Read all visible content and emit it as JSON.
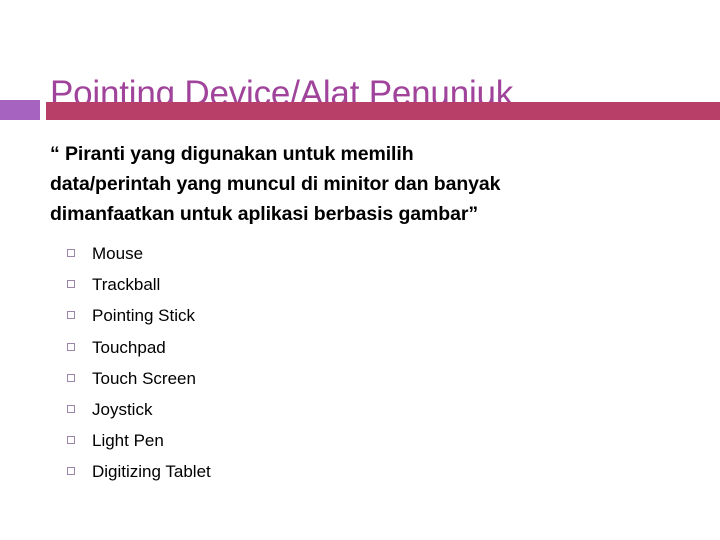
{
  "slide": {
    "title": "Pointing Device/Alat Penunjuk",
    "body_lines": [
      "“ Piranti yang digunakan untuk memilih",
      "data/perintah yang muncul di minitor dan banyak",
      "dimanfaatkan untuk aplikasi berbasis gambar”"
    ],
    "list_items": [
      {
        "label": "Mouse",
        "bullet": "hollow-square-bullet-icon"
      },
      {
        "label": "Trackball",
        "bullet": "hollow-square-bullet-icon"
      },
      {
        "label": "Pointing Stick",
        "bullet": "hollow-square-bullet-icon"
      },
      {
        "label": "Touchpad",
        "bullet": "hollow-square-bullet-icon"
      },
      {
        "label": "Touch Screen",
        "bullet": "hollow-square-bullet-icon"
      },
      {
        "label": "Joystick",
        "bullet": "hollow-square-bullet-icon"
      },
      {
        "label": "Light Pen",
        "bullet": "hollow-square-bullet-icon"
      },
      {
        "label": "Digitizing Tablet",
        "bullet": "hollow-square-bullet-icon"
      }
    ],
    "colors": {
      "title": "#a0439a",
      "divider_block": "#a664c0",
      "divider_bar": "#b83f68",
      "bullet": "#9b85a8",
      "body_text": "#000000",
      "background": "#ffffff"
    }
  }
}
